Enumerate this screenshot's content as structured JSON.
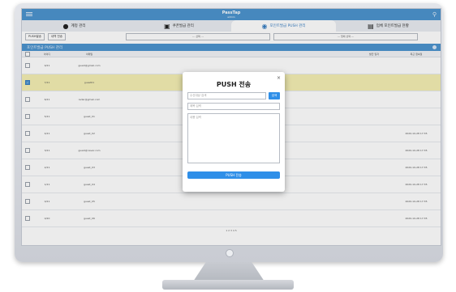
{
  "header": {
    "logo": "PassTap",
    "logo_sub": "admin"
  },
  "tabs": [
    {
      "label": "계정 관리",
      "icon": "user-icon"
    },
    {
      "label": "쿠폰발급 관리",
      "icon": "gift-icon"
    },
    {
      "label": "포인트발급 PUSH 관리",
      "icon": "push-icon"
    },
    {
      "label": "업체 포인트발급 현황",
      "icon": "chart-icon"
    }
  ],
  "filters": {
    "btn1": "PUSH발송",
    "btn2": "내역 전송",
    "select1": "--- 선택 ---",
    "select2": "--- 업체 선택 ---"
  },
  "panel": {
    "title": "포인트발급 PUSH 관리"
  },
  "table": {
    "headers": [
      "",
      "아이디",
      "이메일",
      "",
      "",
      "",
      "",
      "",
      "",
      "발급 일자",
      "최근 접속일"
    ],
    "rows": [
      {
        "checked": false,
        "selected": false,
        "cells": [
          "9/21",
          "guest@gmail.com",
          "",
          "",
          "",
          "",
          "",
          "",
          "",
          ""
        ]
      },
      {
        "checked": true,
        "selected": true,
        "cells": [
          "7/21",
          "guest01",
          "",
          "",
          "",
          "",
          "",
          "",
          "",
          ""
        ]
      },
      {
        "checked": false,
        "selected": false,
        "cells": [
          "6/21",
          "reder@gmail.com",
          "",
          "",
          "",
          "",
          "",
          "",
          "",
          ""
        ]
      },
      {
        "checked": false,
        "selected": false,
        "cells": [
          "5/21",
          "guest_01",
          "",
          "",
          "",
          "",
          "",
          "",
          "",
          ""
        ]
      },
      {
        "checked": false,
        "selected": false,
        "cells": [
          "4/21",
          "guest_02",
          "",
          "",
          "",
          "",
          "",
          "",
          "",
          "2020-10-28 17:35"
        ]
      },
      {
        "checked": false,
        "selected": false,
        "cells": [
          "3/21",
          "guest@naver.com",
          "",
          "",
          "",
          "",
          "",
          "",
          "",
          "2020-10-28 17:35"
        ]
      },
      {
        "checked": false,
        "selected": false,
        "cells": [
          "2/21",
          "guest_03",
          "",
          "",
          "",
          "",
          "",
          "",
          "",
          "2020-10-28 17:35"
        ]
      },
      {
        "checked": false,
        "selected": false,
        "cells": [
          "1/21",
          "guest_04",
          "",
          "",
          "",
          "",
          "",
          "",
          "",
          "2020-10-28 17:35"
        ]
      },
      {
        "checked": false,
        "selected": false,
        "cells": [
          "0/21",
          "guest_05",
          "",
          "",
          "",
          "",
          "",
          "",
          "",
          "2020-10-28 17:35"
        ]
      },
      {
        "checked": false,
        "selected": false,
        "cells": [
          "0/20",
          "guest_06",
          "",
          "",
          "",
          "",
          "",
          "",
          "",
          "2020-10-28 17:35"
        ]
      }
    ]
  },
  "pager": "1 2 3 4 5",
  "modal": {
    "title": "PUSH 전송",
    "close": "×",
    "recipient_placeholder": "수신대상 검색",
    "search_label": "검색",
    "subject_placeholder": "제목 입력",
    "body_placeholder": "내용 입력",
    "send_label": "PUSH 전송"
  }
}
